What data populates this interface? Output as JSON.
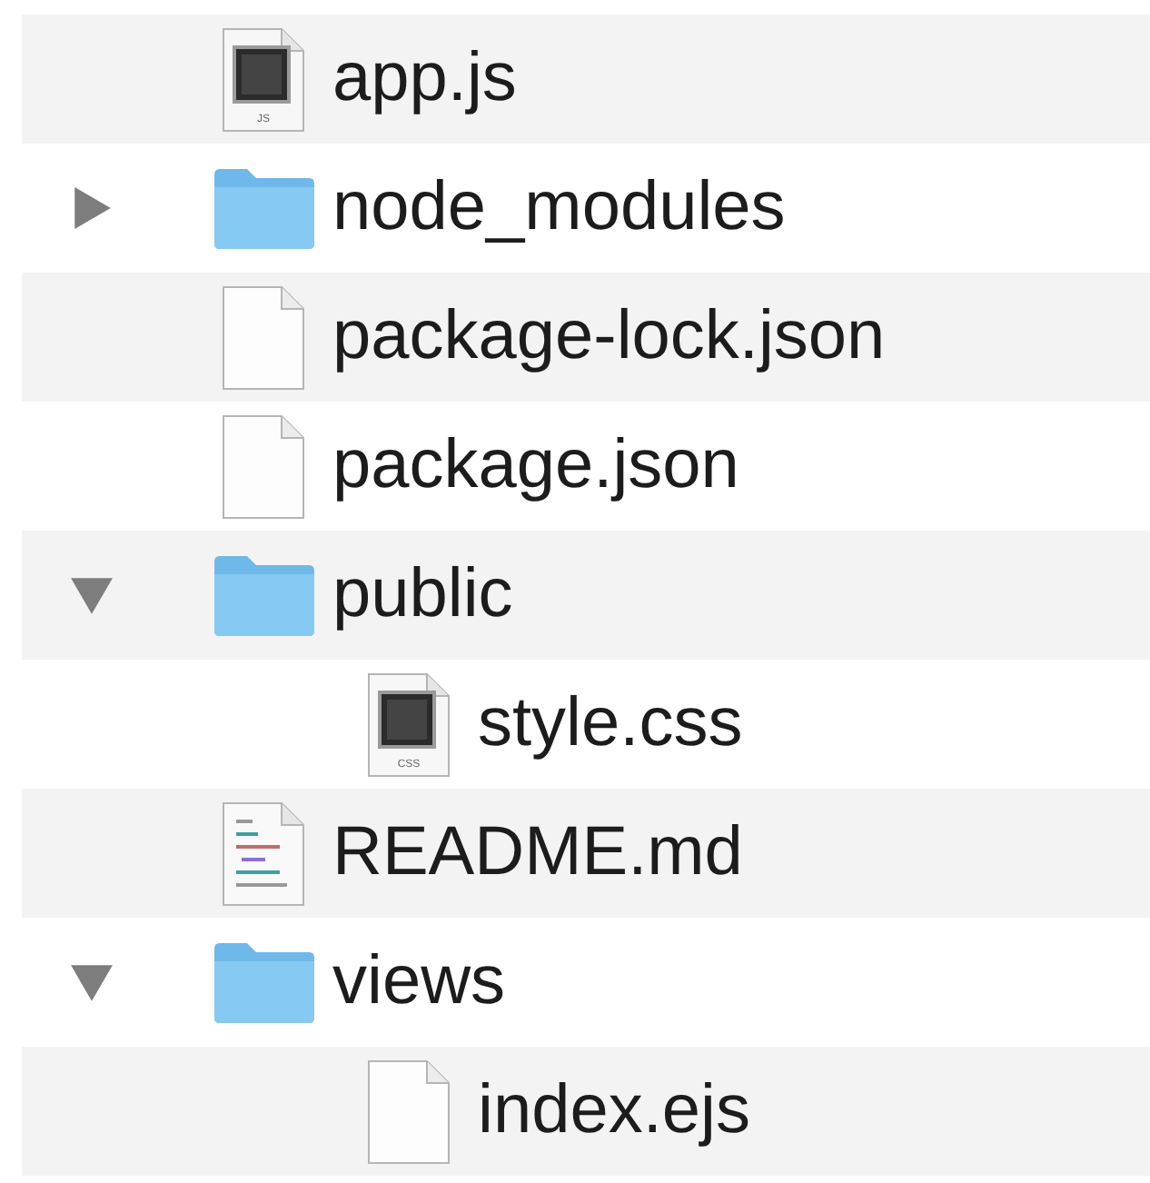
{
  "files": [
    {
      "name": "app.js",
      "kind": "code",
      "badge": "JS"
    },
    {
      "name": "node_modules",
      "kind": "folder",
      "expanded": false
    },
    {
      "name": "package-lock.json",
      "kind": "plain"
    },
    {
      "name": "package.json",
      "kind": "plain"
    },
    {
      "name": "public",
      "kind": "folder",
      "expanded": true,
      "children": [
        {
          "name": "style.css",
          "kind": "code",
          "badge": "CSS"
        }
      ]
    },
    {
      "name": "README.md",
      "kind": "text"
    },
    {
      "name": "views",
      "kind": "folder",
      "expanded": true,
      "children": [
        {
          "name": "index.ejs",
          "kind": "plain"
        }
      ]
    }
  ]
}
